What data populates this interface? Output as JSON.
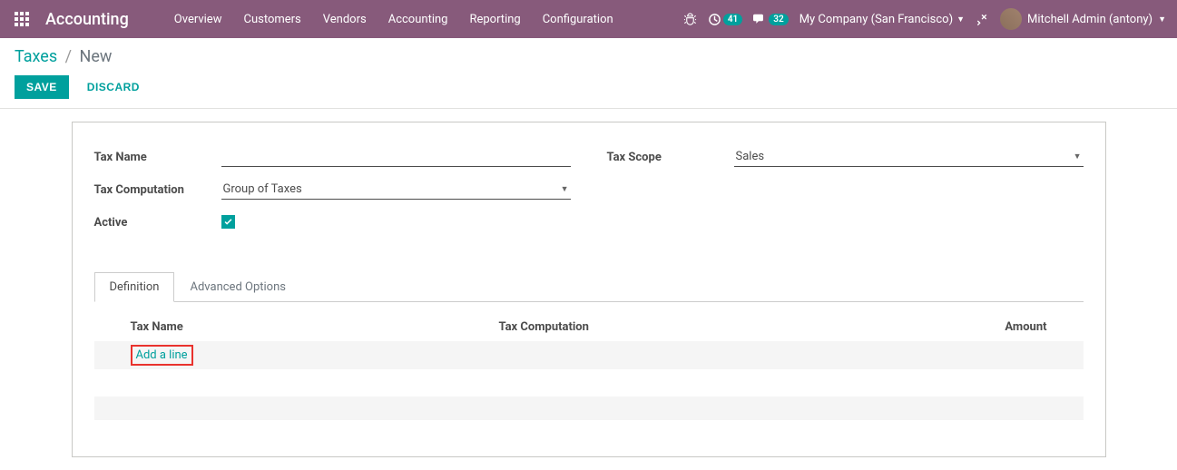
{
  "navbar": {
    "brand": "Accounting",
    "items": [
      "Overview",
      "Customers",
      "Vendors",
      "Accounting",
      "Reporting",
      "Configuration"
    ],
    "clock_badge": "41",
    "chat_badge": "32",
    "company": "My Company (San Francisco)",
    "user": "Mitchell Admin (antony)"
  },
  "breadcrumb": {
    "link": "Taxes",
    "sep": "/",
    "current": "New"
  },
  "buttons": {
    "save": "SAVE",
    "discard": "DISCARD"
  },
  "form": {
    "tax_name_label": "Tax Name",
    "tax_name_value": "",
    "tax_computation_label": "Tax Computation",
    "tax_computation_value": "Group of Taxes",
    "active_label": "Active",
    "tax_scope_label": "Tax Scope",
    "tax_scope_value": "Sales"
  },
  "tabs": {
    "definition": "Definition",
    "advanced": "Advanced Options"
  },
  "table": {
    "col_tax_name": "Tax Name",
    "col_tax_computation": "Tax Computation",
    "col_amount": "Amount",
    "add_line": "Add a line"
  }
}
